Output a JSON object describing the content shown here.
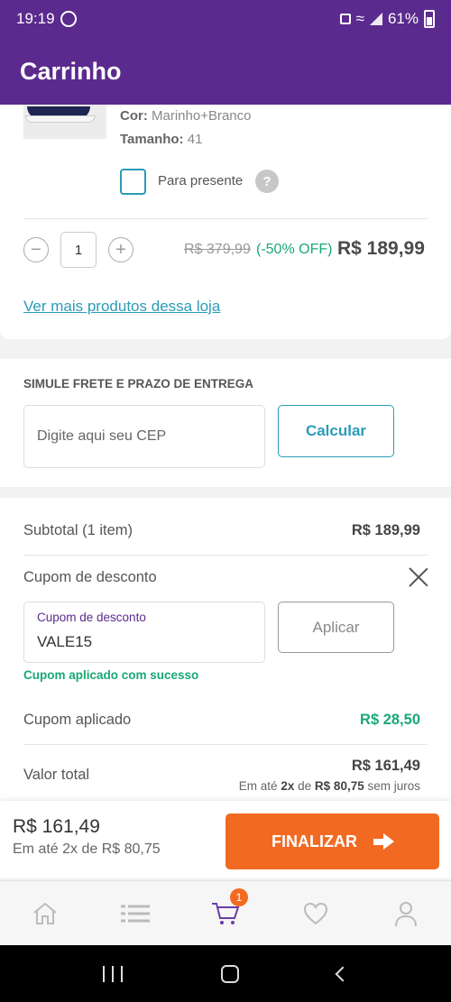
{
  "status_bar": {
    "time": "19:19",
    "battery": "61%"
  },
  "header": {
    "title": "Carrinho"
  },
  "product": {
    "color_label": "Cor:",
    "color_value": "Marinho+Branco",
    "size_label": "Tamanho:",
    "size_value": "41",
    "gift_label": "Para presente",
    "help": "?",
    "quantity": "1",
    "minus": "−",
    "plus": "+",
    "price_old": "R$ 379,99",
    "discount": "(-50% OFF)",
    "price_new": "R$ 189,99",
    "more_link": "Ver mais produtos dessa loja"
  },
  "shipping": {
    "title": "SIMULE FRETE E PRAZO DE ENTREGA",
    "placeholder": "Digite aqui seu CEP",
    "button": "Calcular"
  },
  "summary": {
    "subtotal_label": "Subtotal (1 item)",
    "subtotal_value": "R$ 189,99",
    "coupon_title": "Cupom de desconto",
    "coupon_field_label": "Cupom de desconto",
    "coupon_value": "VALE15",
    "apply_button": "Aplicar",
    "coupon_success": "Cupom aplicado com sucesso",
    "applied_label": "Cupom aplicado",
    "applied_value": "R$ 28,50",
    "total_label": "Valor total",
    "total_value": "R$ 161,49",
    "inst_prefix": "Em até",
    "inst_times": "2x",
    "inst_mid": "de",
    "inst_value": "R$ 80,75",
    "inst_suffix": "sem juros"
  },
  "checkout_bar": {
    "price": "R$ 161,49",
    "installment": "Em até 2x de R$ 80,75",
    "button": "FINALIZAR"
  },
  "nav": {
    "cart_badge": "1"
  },
  "colors": {
    "primary": "#5b2a8e",
    "accent": "#f26a22",
    "link": "#2b9bb8",
    "success": "#19a874"
  }
}
